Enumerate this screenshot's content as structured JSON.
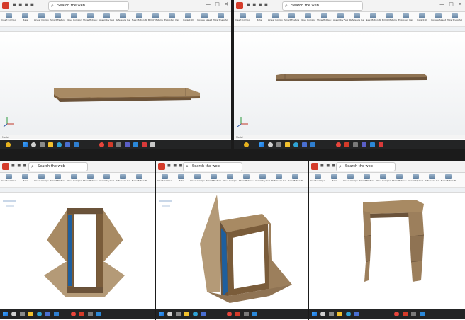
{
  "search": {
    "label": "Search the web"
  },
  "panels": [
    {
      "id": "a",
      "doc_title": "",
      "tabs": [
        "Assembly",
        "Layout",
        "Sketch",
        "Evaluate",
        "SOLIDWORKS Add-Ins"
      ],
      "model_tab": "Model",
      "clock_time": "",
      "clock_date": ""
    },
    {
      "id": "b",
      "doc_title": "",
      "tabs": [
        "Assembly",
        "Layout",
        "Sketch",
        "Evaluate",
        "SOLIDWORKS Add-Ins"
      ],
      "model_tab": "Model",
      "clock_time": "",
      "clock_date": ""
    },
    {
      "id": "c",
      "doc_title": "",
      "tabs": [
        "Assembly",
        "Layout",
        "Sketch",
        "Evaluate",
        "SOLIDWORKS Add-Ins"
      ],
      "model_tab": "Model",
      "clock_time": "",
      "clock_date": ""
    },
    {
      "id": "d",
      "doc_title": "",
      "tabs": [
        "Assembly",
        "Layout",
        "Sketch",
        "Evaluate",
        "SOLIDWORKS Add-Ins"
      ],
      "model_tab": "Model",
      "clock_time": "",
      "clock_date": ""
    },
    {
      "id": "e",
      "doc_title": "",
      "tabs": [
        "Assembly",
        "Layout",
        "Sketch",
        "Evaluate",
        "SOLIDWORKS Add-Ins"
      ],
      "model_tab": "Model",
      "clock_time": "",
      "clock_date": ""
    }
  ],
  "ribbon": {
    "buttons": [
      {
        "label": "Insert Components",
        "icon": "insert-components-icon"
      },
      {
        "label": "Mate",
        "icon": "mate-icon"
      },
      {
        "label": "Linear Component Pattern",
        "icon": "pattern-icon"
      },
      {
        "label": "Smart Fasteners",
        "icon": "fastener-icon"
      },
      {
        "label": "Move Component",
        "icon": "move-icon"
      },
      {
        "label": "Show Hidden Components",
        "icon": "show-hidden-icon"
      },
      {
        "label": "Assembly Features",
        "icon": "assembly-features-icon"
      },
      {
        "label": "Reference Geometry",
        "icon": "reference-geometry-icon"
      },
      {
        "label": "New Motion Study",
        "icon": "motion-study-icon"
      },
      {
        "label": "Bill of Materials",
        "icon": "bom-icon"
      },
      {
        "label": "Exploded View",
        "icon": "exploded-view-icon"
      },
      {
        "label": "Instant3D",
        "icon": "instant3d-icon"
      },
      {
        "label": "Update SpeedPak",
        "icon": "speedpak-icon"
      },
      {
        "label": "Take Snapshot",
        "icon": "snapshot-icon"
      },
      {
        "label": "Large Assembly Settings",
        "icon": "settings-icon"
      }
    ]
  },
  "taskbar": {
    "icons": [
      "start-icon",
      "search-icon",
      "task-view-icon",
      "file-explorer-icon",
      "edge-icon",
      "store-icon",
      "mail-icon",
      "chrome-icon",
      "solidworks-icon",
      "settings-icon",
      "teams-icon",
      "photos-icon"
    ]
  },
  "colors": {
    "wood": "#8f7353",
    "wood_light": "#a88a63",
    "wood_dark": "#6b533a",
    "glass": "#1e5f9e",
    "frame": "#7a5c3a",
    "accent": "#d43b2a"
  }
}
